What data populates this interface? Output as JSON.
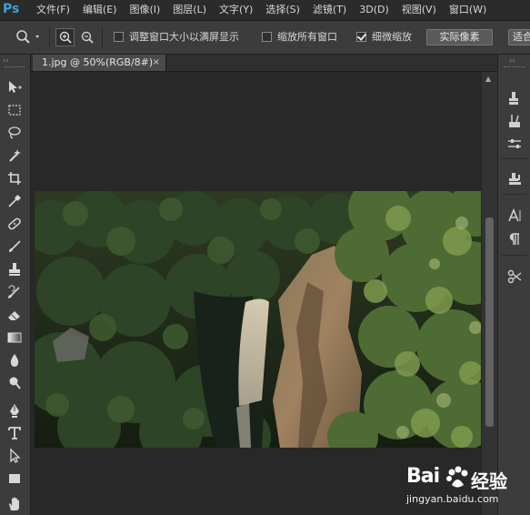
{
  "app": {
    "logo": "Ps"
  },
  "menu": [
    "文件(F)",
    "编辑(E)",
    "图像(I)",
    "图层(L)",
    "文字(Y)",
    "选择(S)",
    "滤镜(T)",
    "3D(D)",
    "视图(V)",
    "窗口(W)"
  ],
  "options": {
    "resize_windows_label": "调整窗口大小以满屏显示",
    "resize_windows_checked": false,
    "zoom_all_label": "缩放所有窗口",
    "zoom_all_checked": false,
    "scrubby_zoom_label": "细微缩放",
    "scrubby_zoom_checked": true,
    "actual_pixels_label": "实际像素",
    "fit_screen_label": "适合"
  },
  "document": {
    "tab_label": "1.jpg @ 50%(RGB/8#)",
    "close_glyph": "×"
  },
  "tools": [
    "move-tool-icon",
    "marquee-tool-icon",
    "lasso-tool-icon",
    "quick-select-tool-icon",
    "crop-tool-icon",
    "eyedropper-tool-icon",
    "healing-brush-tool-icon",
    "brush-tool-icon",
    "clone-stamp-tool-icon",
    "history-brush-tool-icon",
    "eraser-tool-icon",
    "gradient-tool-icon",
    "blur-tool-icon",
    "dodge-tool-icon",
    "pen-tool-icon",
    "type-tool-icon",
    "path-select-tool-icon",
    "rectangle-tool-icon",
    "hand-tool-icon"
  ],
  "watermark": {
    "brand": "Bai",
    "brand2": "经验",
    "url": "jingyan.baidu.com"
  },
  "colors": {
    "ps_blue": "#3fa1d6",
    "panel": "#3c3c3c",
    "canvas": "#282828"
  }
}
